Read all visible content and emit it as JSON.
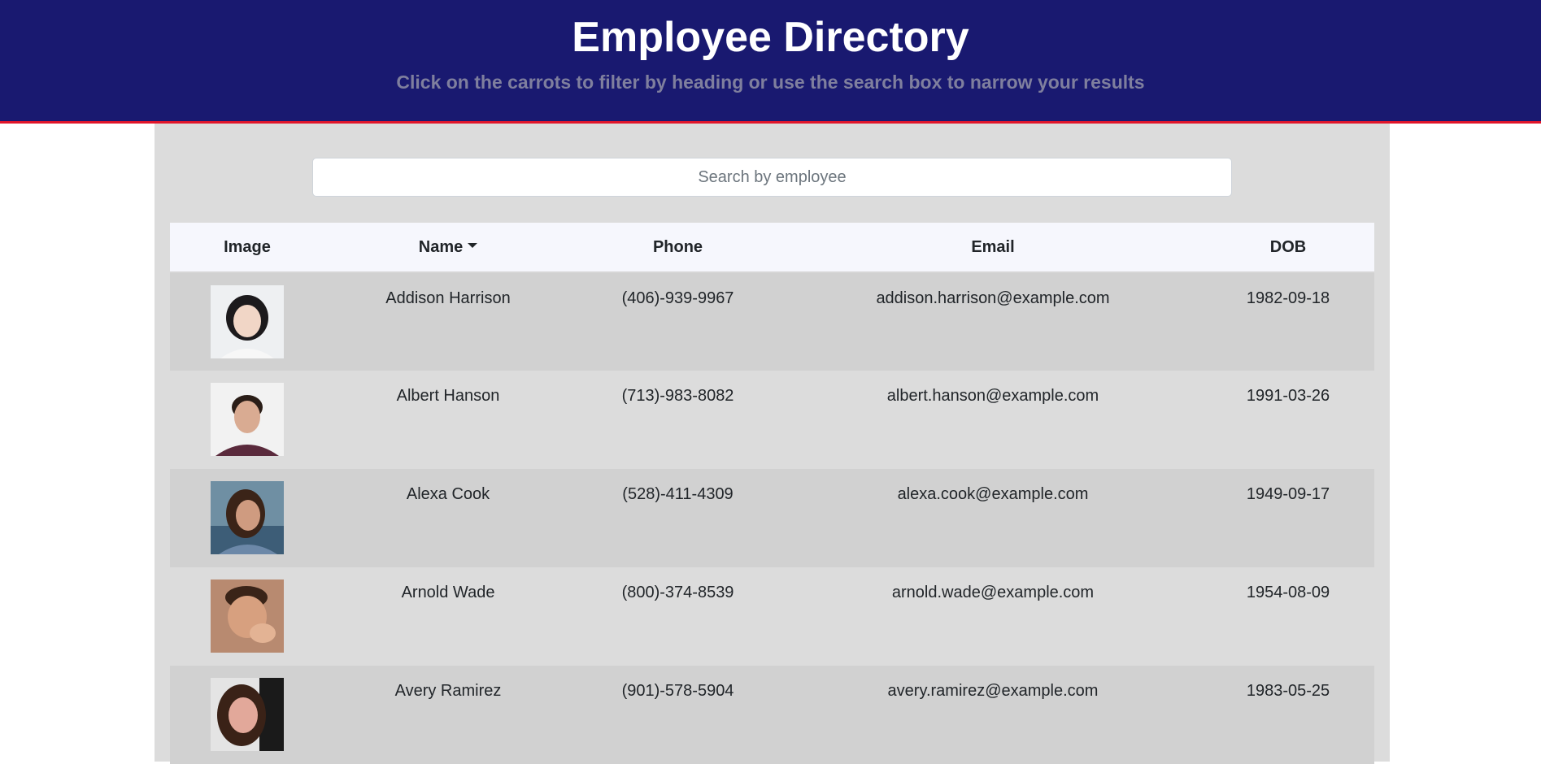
{
  "header": {
    "title": "Employee Directory",
    "subtitle": "Click on the carrots to filter by heading or use the search box to narrow your results"
  },
  "search": {
    "placeholder": "Search by employee",
    "value": ""
  },
  "table": {
    "columns": [
      "Image",
      "Name",
      "Phone",
      "Email",
      "DOB"
    ],
    "sorted_by": "Name",
    "rows": [
      {
        "name": "Addison Harrison",
        "phone": "(406)-939-9967",
        "email": "addison.harrison@example.com",
        "dob": "1982-09-18"
      },
      {
        "name": "Albert Hanson",
        "phone": "(713)-983-8082",
        "email": "albert.hanson@example.com",
        "dob": "1991-03-26"
      },
      {
        "name": "Alexa Cook",
        "phone": "(528)-411-4309",
        "email": "alexa.cook@example.com",
        "dob": "1949-09-17"
      },
      {
        "name": "Arnold Wade",
        "phone": "(800)-374-8539",
        "email": "arnold.wade@example.com",
        "dob": "1954-08-09"
      },
      {
        "name": "Avery Ramirez",
        "phone": "(901)-578-5904",
        "email": "avery.ramirez@example.com",
        "dob": "1983-05-25"
      }
    ]
  },
  "colors": {
    "header_bg": "#191970",
    "header_border": "#e0152b",
    "panel_bg": "#dcdcdc",
    "row_odd_bg": "#d1d1d1",
    "table_head_bg": "#f6f7fd"
  }
}
